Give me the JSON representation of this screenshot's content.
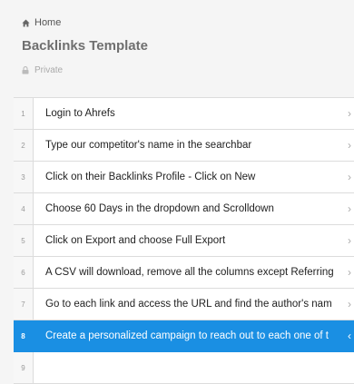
{
  "breadcrumb": {
    "label": "Home"
  },
  "page": {
    "title": "Backlinks Template",
    "privacy": "Private"
  },
  "steps": [
    {
      "num": "1",
      "text": "Login to Ahrefs"
    },
    {
      "num": "2",
      "text": "Type our competitor's name in the searchbar"
    },
    {
      "num": "3",
      "text": "Click on their Backlinks Profile - Click on New"
    },
    {
      "num": "4",
      "text": "Choose 60 Days in the dropdown and Scrolldown"
    },
    {
      "num": "5",
      "text": "Click on Export and choose Full Export"
    },
    {
      "num": "6",
      "text": "A CSV will download, remove all the columns except Referring"
    },
    {
      "num": "7",
      "text": "Go to each link and access the URL and find the author's nam"
    },
    {
      "num": "8",
      "text": "Create a personalized campaign to reach out to each one of t"
    },
    {
      "num": "9",
      "text": ""
    }
  ],
  "colors": {
    "accent": "#1a8fe3"
  },
  "icons": {
    "breadcrumb": "home-icon",
    "privacy": "lock-icon",
    "row": "chevron-right-icon",
    "active_row": "chevron-left-icon"
  }
}
